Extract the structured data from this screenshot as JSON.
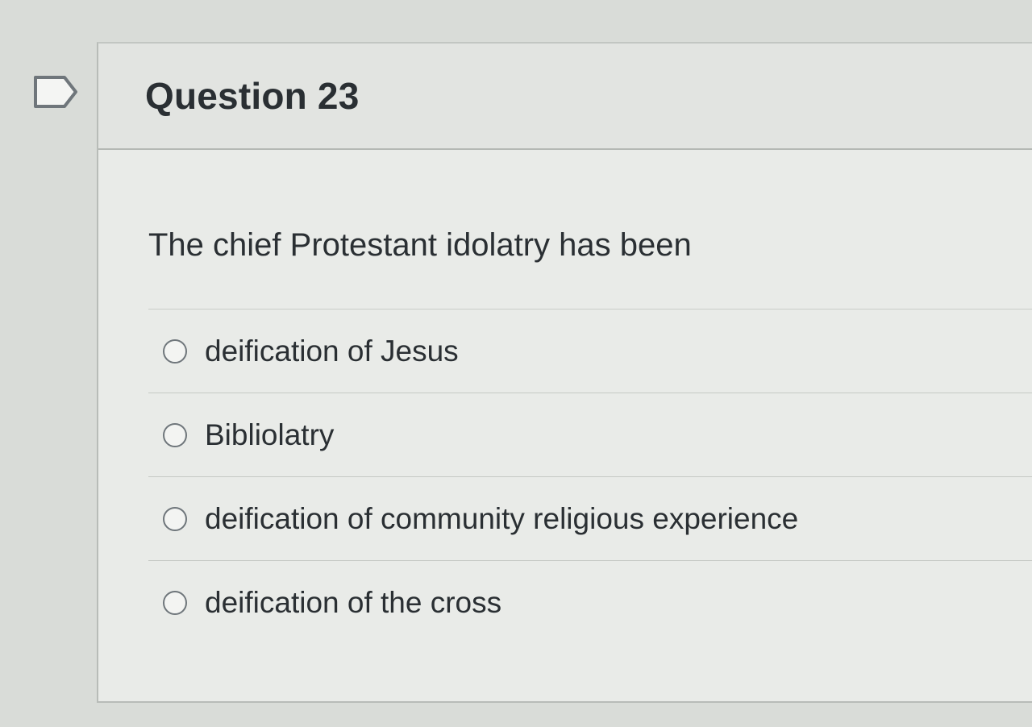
{
  "question": {
    "title": "Question 23",
    "text": "The chief Protestant idolatry has been",
    "flag_icon": "flag-outline-icon",
    "answers": [
      {
        "label": "deification of Jesus",
        "selected": false
      },
      {
        "label": "Bibliolatry",
        "selected": false
      },
      {
        "label": "deification of community religious experience",
        "selected": false
      },
      {
        "label": "deification of the cross",
        "selected": false
      }
    ]
  }
}
